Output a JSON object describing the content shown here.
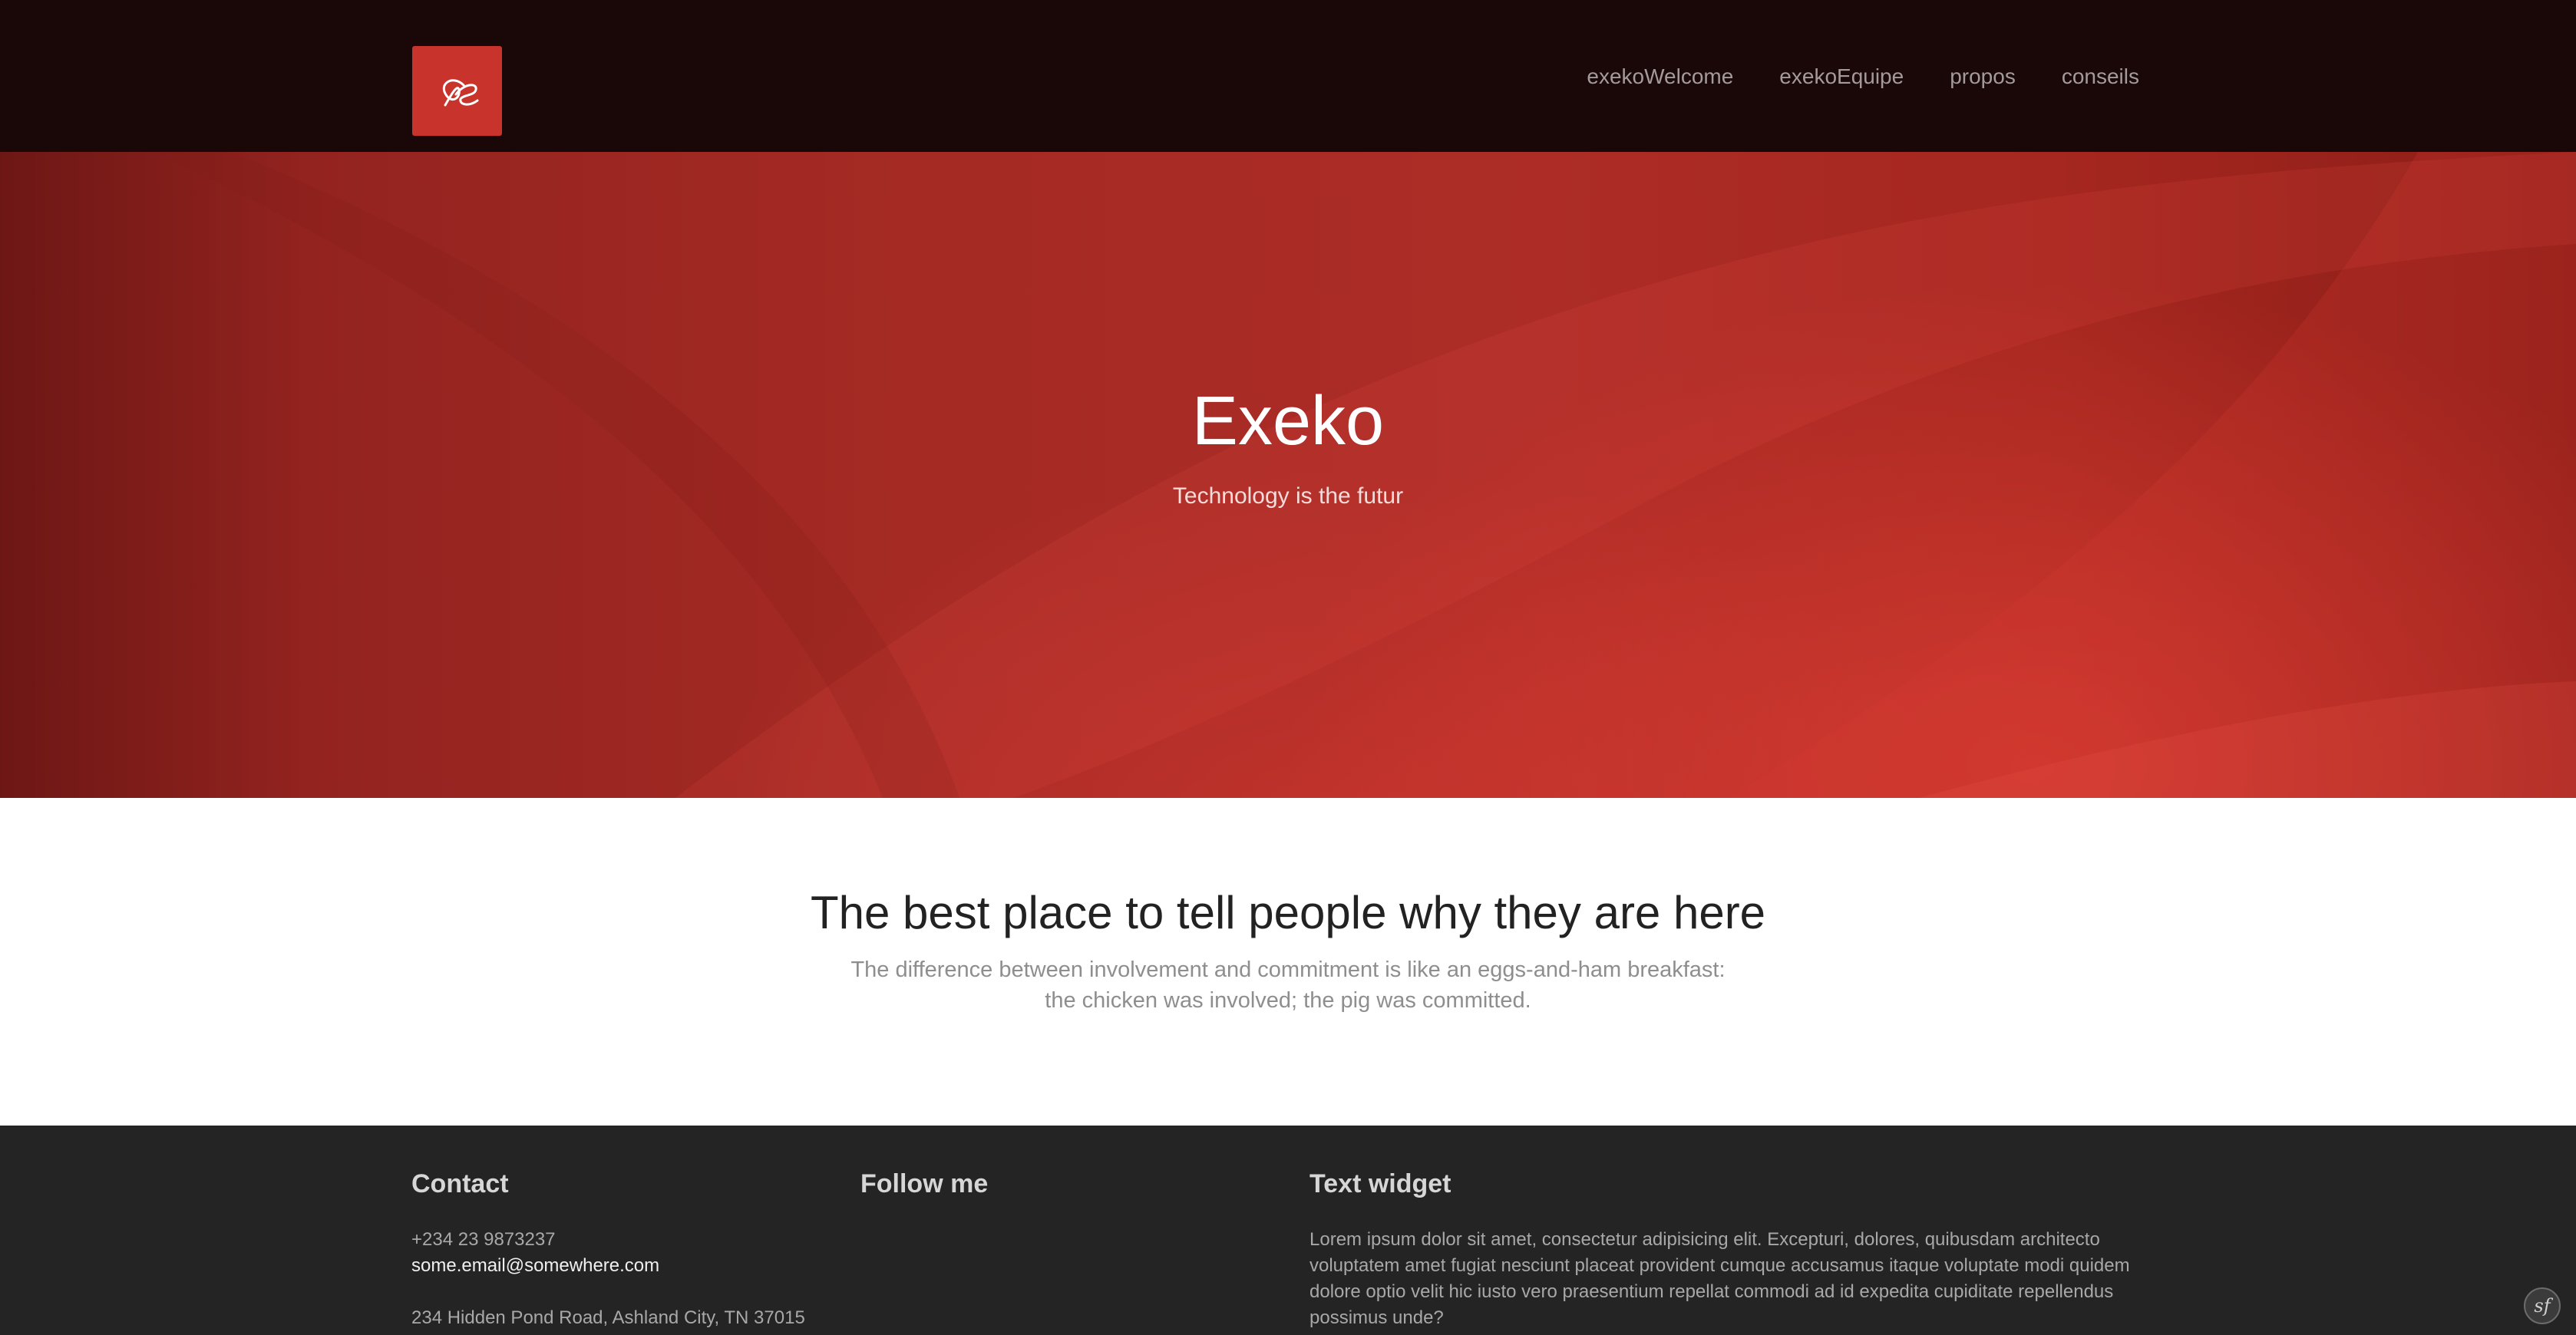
{
  "header": {
    "logo_glyph": "æ",
    "brand_color": "#c8332b",
    "nav": [
      {
        "label": "exekoWelcome"
      },
      {
        "label": "exekoEquipe"
      },
      {
        "label": "propos"
      },
      {
        "label": "conseils"
      }
    ]
  },
  "hero": {
    "title": "Exeko",
    "subtitle": "Technology is the futur"
  },
  "intro": {
    "heading": "The best place to tell people why they are here",
    "line1": "The difference between involvement and commitment is like an eggs-and-ham breakfast:",
    "line2": "the chicken was involved; the pig was committed."
  },
  "footer": {
    "contact": {
      "title": "Contact",
      "phone": "+234 23 9873237",
      "email": "some.email@somewhere.com",
      "address": "234 Hidden Pond Road, Ashland City, TN 37015"
    },
    "follow": {
      "title": "Follow me"
    },
    "text_widget": {
      "title": "Text widget",
      "body": "Lorem ipsum dolor sit amet, consectetur adipisicing elit. Excepturi, dolores, quibusdam architecto voluptatem amet fugiat nesciunt placeat provident cumque accusamus itaque voluptate modi quidem dolore optio velit hic iusto vero praesentium repellat commodi ad id expedita cupiditate repellendus possimus unde?"
    }
  },
  "badge": {
    "glyph": "sf"
  }
}
